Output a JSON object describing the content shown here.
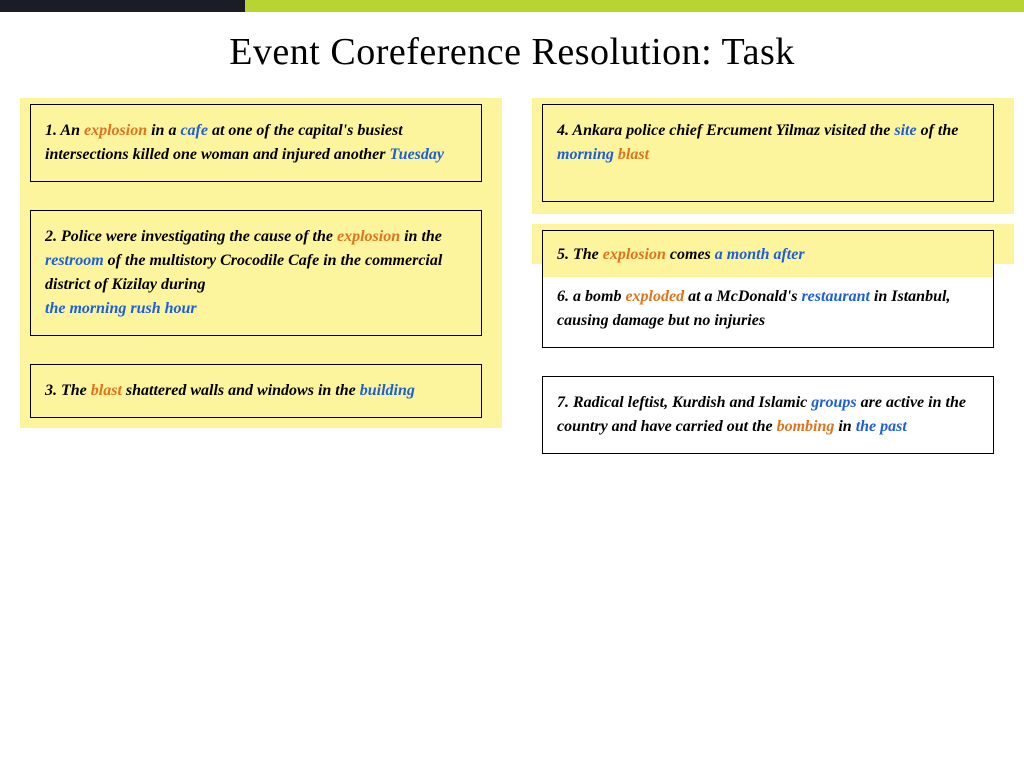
{
  "title": "Event Coreference Resolution: Task",
  "left": {
    "box1": {
      "num": "1.",
      "t1": "An ",
      "w1": "explosion",
      "t2": " in a ",
      "w2": "cafe",
      "t3": " at one of the capital's busiest intersections killed one woman and injured another ",
      "w3": "Tuesday"
    },
    "box2": {
      "num": "2.",
      "t1": " Police were investigating the cause of the ",
      "w1": "explosion",
      "t2": " in the ",
      "w2": "restroom",
      "t3": " of the multistory Crocodile Cafe in the commercial district of Kizilay during ",
      "w3": "the morning rush hour"
    },
    "box3": {
      "num": "3.",
      "t1": " The ",
      "w1": "blast",
      "t2": " shattered walls and windows in the ",
      "w2": "building"
    }
  },
  "right": {
    "box4": {
      "num": "4.",
      "t1": " Ankara police chief Ercument Yilmaz visited the ",
      "w1": "site",
      "t2": " of the ",
      "w2": "morning",
      "sp": " ",
      "w3": "blast"
    },
    "box5": {
      "num": "5.",
      "t1": " The ",
      "w1": "explosion",
      "t2": " comes ",
      "w2": "a month after"
    },
    "box6": {
      "num": "6.",
      "t1": " a bomb ",
      "w1": "exploded",
      "t2": " at a McDonald's ",
      "w2": "restaurant",
      "t3": " in Istanbul, causing damage but no injuries"
    },
    "box7": {
      "num": "7.",
      "t1": " Radical leftist, Kurdish and Islamic ",
      "w1": "groups",
      "t2": " are active in the country and have carried out the ",
      "w2": "bombing",
      "t3": " in ",
      "w3": "the past"
    }
  }
}
